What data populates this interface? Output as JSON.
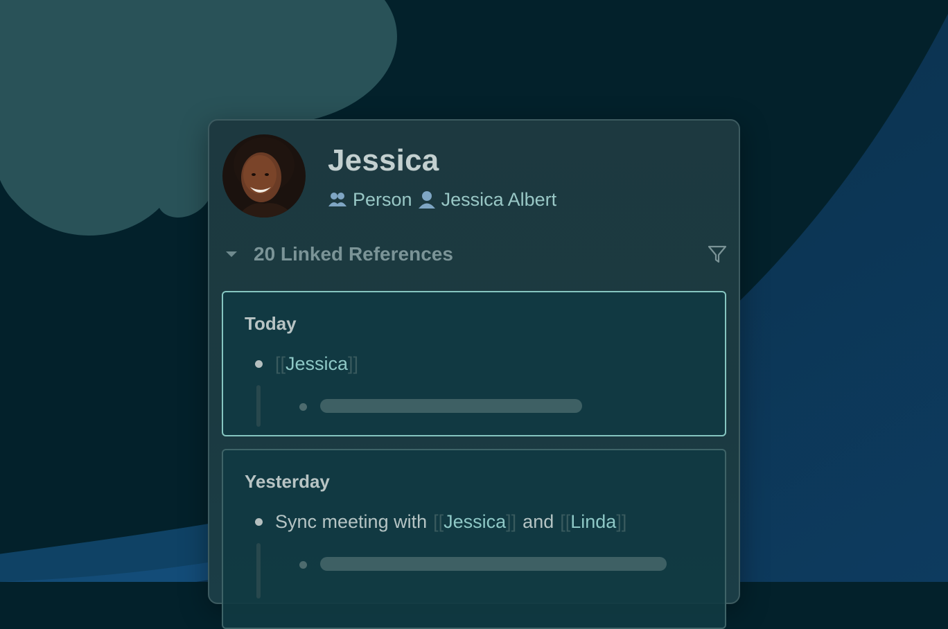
{
  "colors": {
    "background": "#03212b",
    "cloud": "#2e5a5f",
    "wave": "#0f3b5a",
    "card": "#1b3a41",
    "accent": "#86c6c1",
    "link": "#8ec8c6"
  },
  "page": {
    "title": "Jessica",
    "avatar_alt": "Jessica",
    "meta": [
      {
        "icon": "people-icon",
        "label": "Person"
      },
      {
        "icon": "person-icon",
        "label": "Jessica Albert"
      }
    ]
  },
  "references": {
    "title": "20 Linked References",
    "groups": [
      {
        "date": "Today",
        "open_bracket": "[[",
        "link": "Jessica",
        "close_bracket": "]]",
        "child_placeholder": "skeleton"
      },
      {
        "date": "Yesterday",
        "text_before": "Sync meeting with",
        "open_bracket_1": "[[",
        "link_1": "Jessica",
        "close_bracket_1": "]]",
        "text_middle": "and",
        "open_bracket_2": "[[",
        "link_2": "Linda",
        "close_bracket_2": "]]",
        "child_placeholder": "skeleton"
      }
    ]
  }
}
